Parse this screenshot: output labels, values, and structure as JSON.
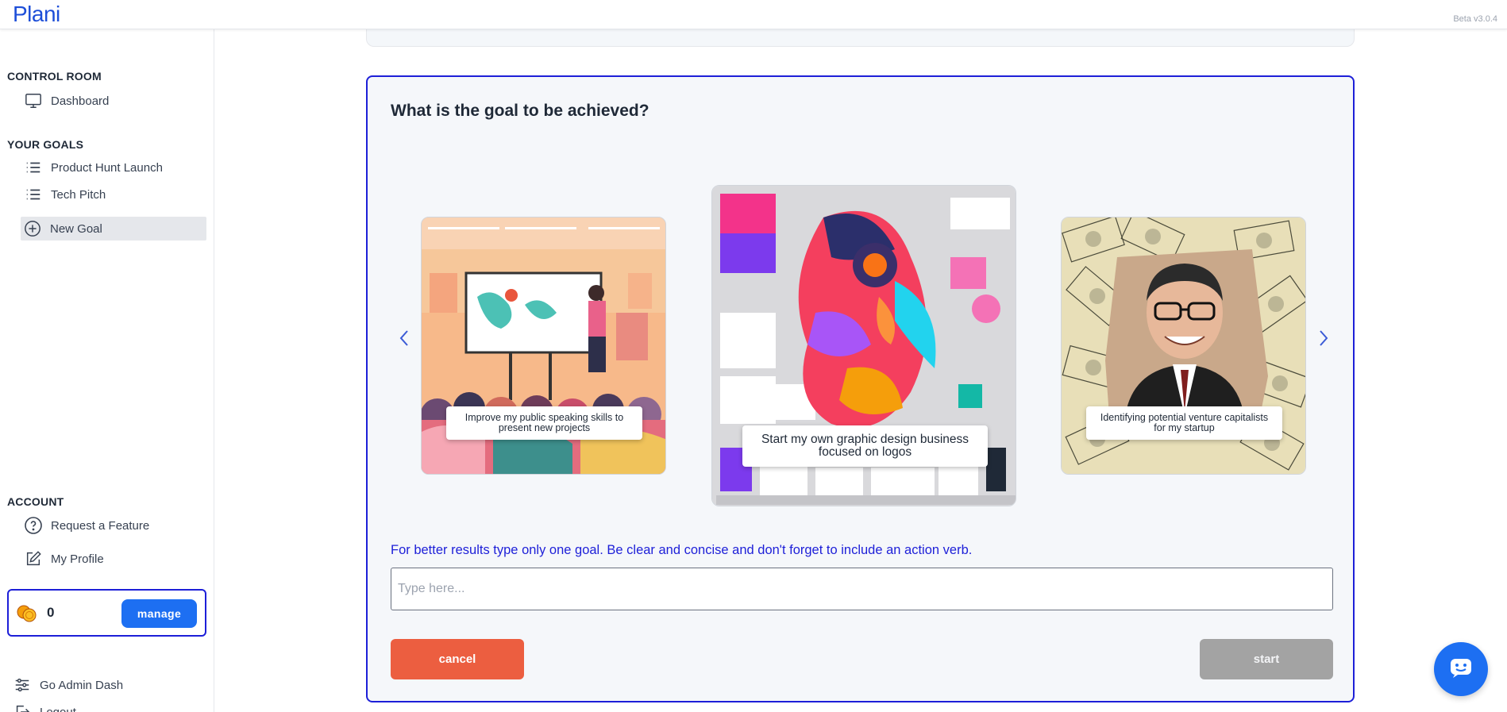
{
  "app": {
    "logo": "Plani",
    "version": "Beta v3.0.4"
  },
  "sidebar": {
    "control_room_title": "CONTROL ROOM",
    "dashboard_label": "Dashboard",
    "goals_title": "YOUR GOALS",
    "goals": [
      {
        "label": "Product Hunt Launch"
      },
      {
        "label": "Tech Pitch"
      }
    ],
    "new_goal_label": "New Goal",
    "account_title": "ACCOUNT",
    "request_feature_label": "Request a Feature",
    "my_profile_label": "My Profile",
    "credits": {
      "count": "0",
      "manage_label": "manage"
    },
    "admin_label": "Go Admin Dash",
    "logout_label": "Logout"
  },
  "main": {
    "title": "What is the goal to be achieved?",
    "carousel": [
      {
        "caption": "Improve my public speaking skills to present new projects"
      },
      {
        "caption": "Start my own graphic design business focused on logos"
      },
      {
        "caption": "Identifying potential venture capitalists for my startup"
      }
    ],
    "hint": "For better results type only one goal. Be clear and concise and don't forget to include an action verb.",
    "input": {
      "placeholder": "Type here...",
      "value": ""
    },
    "cancel_label": "cancel",
    "start_label": "start"
  },
  "colors": {
    "brand": "#1d1fd8",
    "primary_button": "#1d6ff2",
    "cancel": "#ec5e40",
    "start_disabled": "#a3a3a3"
  },
  "icons": {
    "dashboard": "monitor-icon",
    "goal": "list-icon",
    "new_goal": "plus-circle-icon",
    "request_feature": "question-circle-icon",
    "profile": "edit-icon",
    "coins": "coins-icon",
    "admin": "sliders-icon",
    "logout": "logout-icon",
    "chat": "chat-bot-icon"
  }
}
